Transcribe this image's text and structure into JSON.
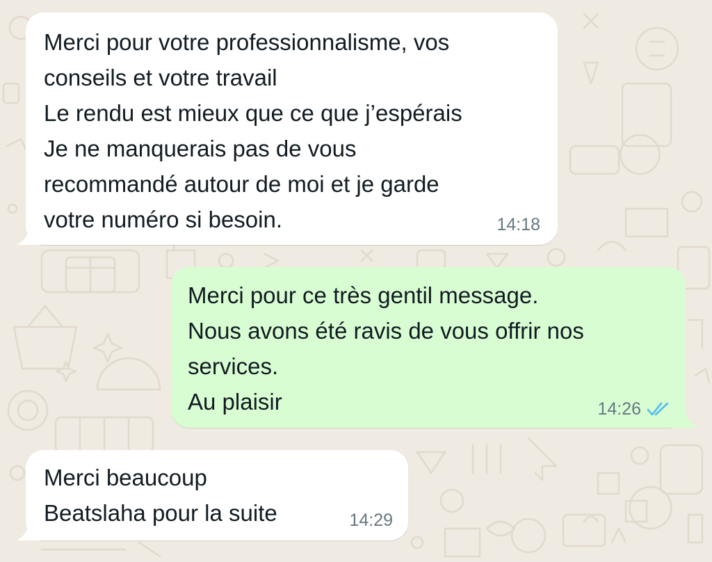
{
  "conversation": {
    "messages": [
      {
        "direction": "incoming",
        "lines": [
          "Merci pour votre professionnalisme, vos",
          "conseils et votre travail",
          "Le rendu est mieux que ce que j’espérais",
          "Je ne manquerais pas de vous",
          "recommandé autour de moi et je garde",
          "votre numéro si besoin."
        ],
        "time": "14:18"
      },
      {
        "direction": "outgoing",
        "lines": [
          "Merci pour ce très gentil message.",
          "Nous avons été ravis de vous offrir nos",
          "services.",
          "Au plaisir"
        ],
        "time": "14:26",
        "status_icon": "double-check-read-icon"
      },
      {
        "direction": "incoming",
        "lines": [
          "Merci beaucoup",
          "Beatslaha pour la suite"
        ],
        "time": "14:29"
      }
    ]
  },
  "theme": {
    "background": "#efeae2",
    "incoming_bubble": "#ffffff",
    "outgoing_bubble": "#d9fdd3",
    "text": "#111b21",
    "timestamp": "#667781",
    "read_receipt": "#53bdeb"
  }
}
